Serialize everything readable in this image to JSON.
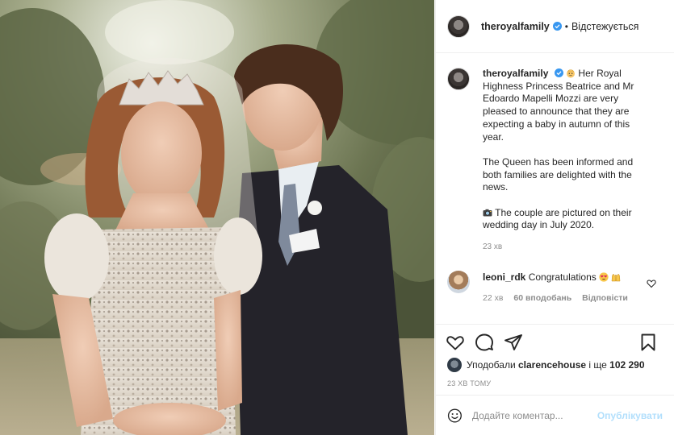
{
  "post": {
    "image_alt": "Photo",
    "colors": {
      "verified": "#3897f0",
      "publish": "#b2dffc",
      "heart_red": "#ed4956"
    }
  },
  "header": {
    "username": "theroyalfamily",
    "separator": "•",
    "follow_state": "Відстежується"
  },
  "caption": {
    "username": "theroyalfamily",
    "paragraphs": [
      "Her Royal Highness Princess Beatrice and Mr Edoardo Mapelli Mozzi are very pleased to announce that they are expecting a baby in autumn of this year.",
      "The Queen has been informed and both families are delighted with the news.",
      "The couple are pictured on their wedding day in July 2020."
    ],
    "time": "23 хв",
    "emoji": [
      "baby-emoji",
      "camera-emoji"
    ]
  },
  "comment": {
    "username": "leoni_rdk",
    "text": "Congratulations",
    "emoji": [
      "heart-eyes-emoji",
      "raised-hands-emoji"
    ],
    "time": "22 хв",
    "likes": "60 вподобань",
    "reply": "Відповісти"
  },
  "likes": {
    "prefix": "Уподобали",
    "user": "clarencehouse",
    "middle": "і ще",
    "count": "102 290"
  },
  "timestamp": "23 ХВ ТОМУ",
  "add_comment": {
    "placeholder": "Додайте коментар...",
    "publish": "Опублікувати"
  },
  "icons": [
    "heart-icon",
    "comment-icon",
    "share-icon",
    "bookmark-icon",
    "emoji-icon",
    "verified-icon"
  ]
}
